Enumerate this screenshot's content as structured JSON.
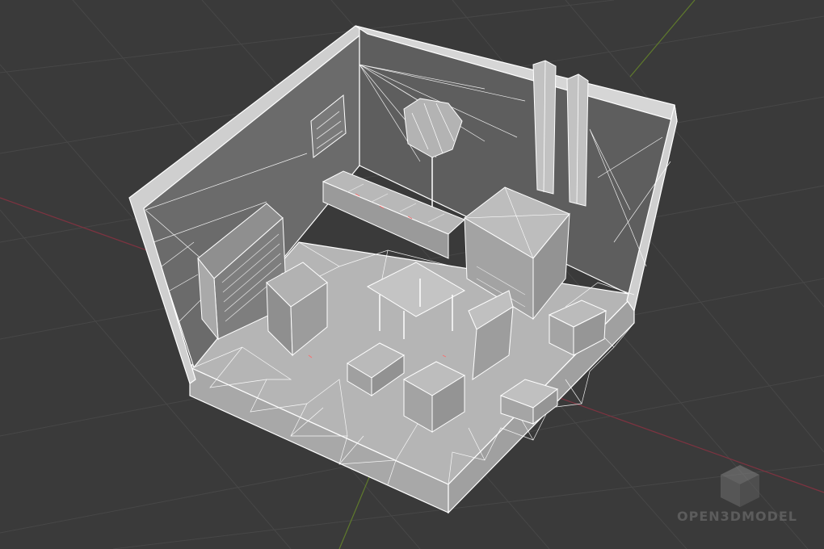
{
  "viewport": {
    "background": "#3a3a3a",
    "grid_color": "#454545",
    "axis_x_color": "#8a3a44",
    "axis_y_color": "#5f7a2c",
    "wire_color": "#ffffff",
    "floor_fill": "#b9b9b9",
    "wall_fill": "#9a9a9a"
  },
  "objects": [
    "room-shell",
    "left-wall",
    "back-wall",
    "floor",
    "bookshelf",
    "wall-shelf",
    "lamp",
    "desk-counter",
    "wardrobe",
    "pillars",
    "armchair",
    "table",
    "stool",
    "cabinet",
    "crate"
  ],
  "watermark": {
    "text": "OPEN3DMODEL",
    "icon": "cube-icon"
  }
}
